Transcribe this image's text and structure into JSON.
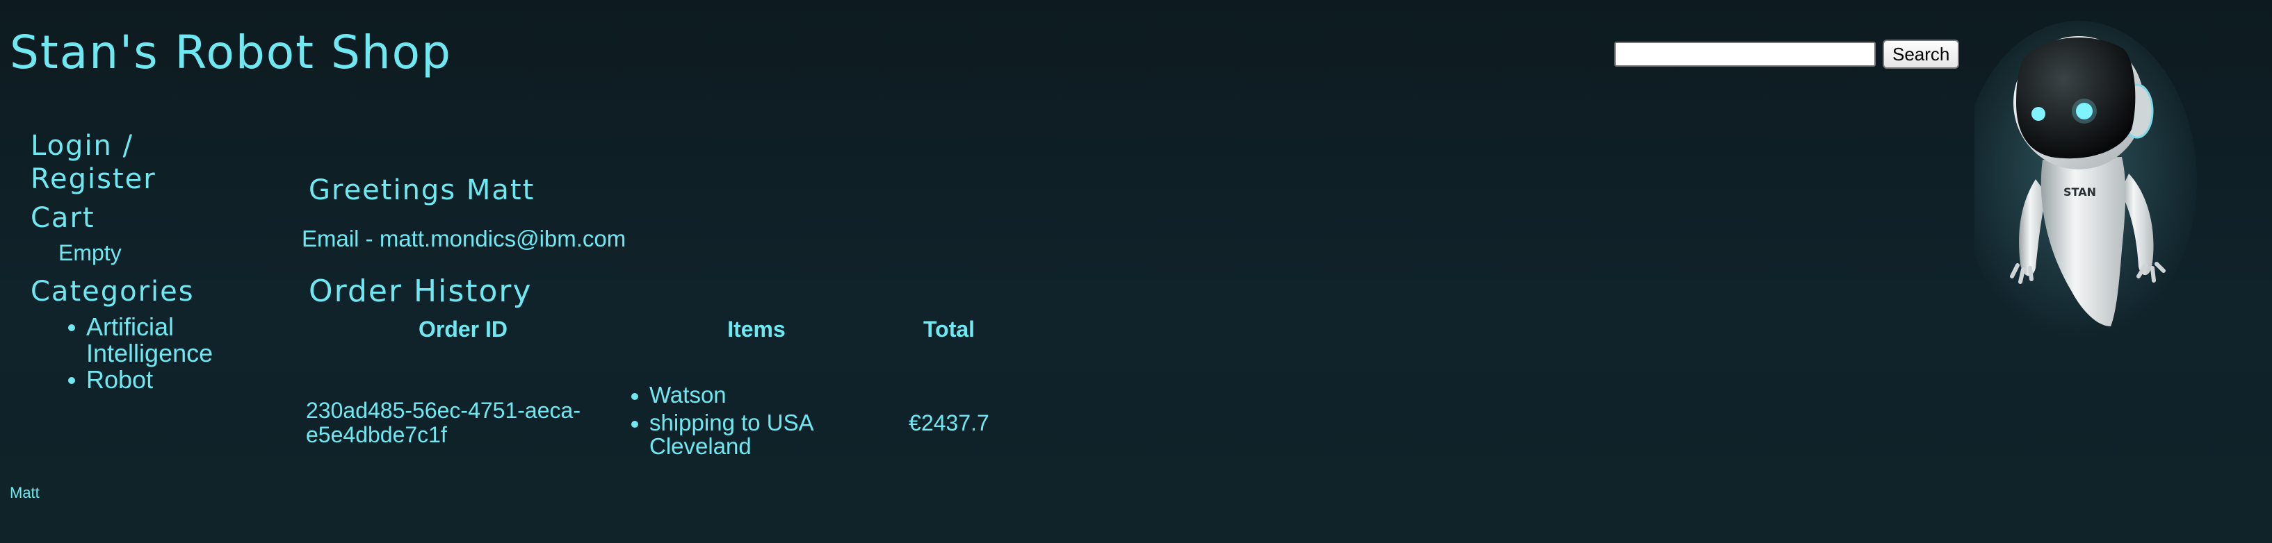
{
  "header": {
    "title": "Stan's Robot Shop"
  },
  "search": {
    "input_value": "",
    "button_label": "Search"
  },
  "sidebar": {
    "login_label": "Login / Register",
    "cart_label": "Cart",
    "cart_status": "Empty",
    "categories_label": "Categories",
    "categories": [
      {
        "label": "Artificial Intelligence"
      },
      {
        "label": "Robot"
      }
    ]
  },
  "main": {
    "greeting": "Greetings Matt",
    "email_line": "Email - matt.mondics@ibm.com",
    "order_history_title": "Order History",
    "order_table": {
      "headers": [
        "Order ID",
        "Items",
        "Total"
      ],
      "rows": [
        {
          "order_id": "230ad485-56ec-4751-aeca-e5e4dbde7c1f",
          "items": [
            "Watson",
            "shipping to USA Cleveland"
          ],
          "total": "€2437.7"
        }
      ]
    }
  },
  "robot_badge_text": "STAN",
  "footer": {
    "user": "Matt"
  },
  "colors": {
    "accent": "#6fe8f2",
    "background": "#0f1f25"
  },
  "icons": {
    "mascot": "stan-robot-mascot"
  }
}
